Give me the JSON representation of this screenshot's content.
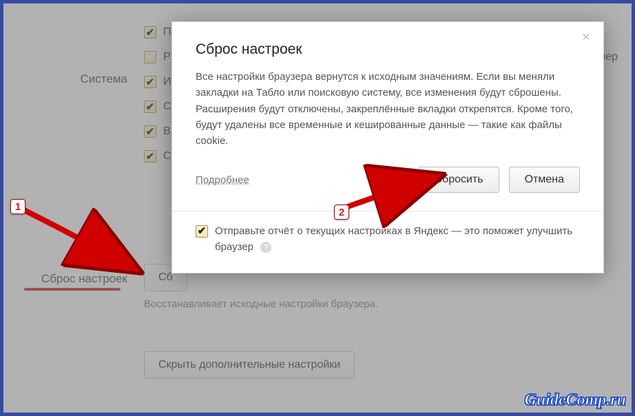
{
  "sidebar": {
    "system_label": "Система",
    "reset_label": "Сброс настроек"
  },
  "settings": {
    "options": [
      {
        "checked": true,
        "label": "Показывать иконку Яндекса в трее"
      },
      {
        "checked": false,
        "label": "Р"
      },
      {
        "checked": true,
        "label": "И"
      },
      {
        "checked": true,
        "label": "С"
      },
      {
        "checked": true,
        "label": "В"
      },
      {
        "checked": true,
        "label": "С"
      }
    ],
    "trailing_right": "раузер",
    "reset_button": "Сб",
    "reset_description": "Восстанавливает исходные настройки браузера.",
    "hide_additional_button": "Скрыть дополнительные настройки"
  },
  "modal": {
    "title": "Сброс настроек",
    "description": "Все настройки браузера вернутся к исходным значениям. Если вы меняли закладки на Табло или поисковую систему, все изменения будут сброшены. Расширения будут отключены, закреплённые вкладки открепятся. Кроме того, будут удалены все временные и кешированные данные — такие как файлы cookie.",
    "more_link": "Подробнее",
    "confirm_button": "Сбросить",
    "cancel_button": "Отмена",
    "report_checkbox_label": "Отправьте отчёт о текущих настройках в Яндекс — это поможет улучшить браузер",
    "report_checked": true
  },
  "annotations": {
    "marker1": "1",
    "marker2": "2"
  },
  "watermark": "GuideComp.ru"
}
